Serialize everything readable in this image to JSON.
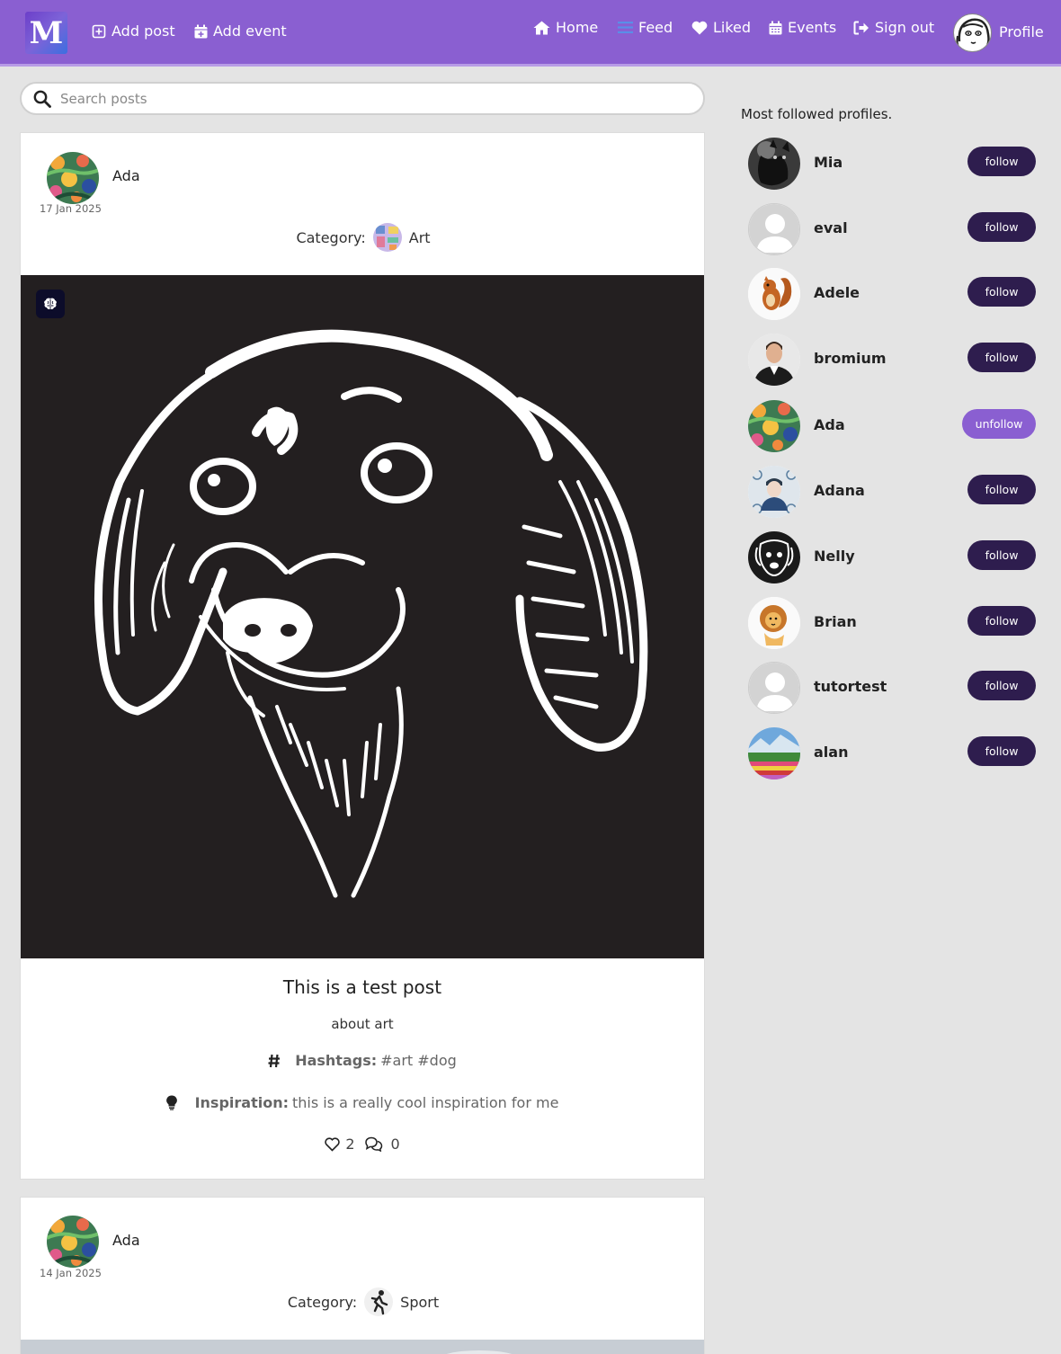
{
  "nav": {
    "logo_letter": "M",
    "add_post": "Add post",
    "add_event": "Add event",
    "home": "Home",
    "feed": "Feed",
    "liked": "Liked",
    "events": "Events",
    "sign_out": "Sign out",
    "profile": "Profile"
  },
  "search": {
    "placeholder": "Search posts"
  },
  "posts": [
    {
      "author": "Ada",
      "date": "17 Jan 2025",
      "category_label": "Category:",
      "category": "Art",
      "title": "This is a test post",
      "subtitle": "about art",
      "hashtags_label": "Hashtags:",
      "hashtags": "#art #dog",
      "inspiration_label": "Inspiration:",
      "inspiration": "this is a really cool inspiration for me",
      "likes": "2",
      "comments": "0"
    },
    {
      "author": "Ada",
      "date": "14 Jan 2025",
      "category_label": "Category:",
      "category": "Sport"
    }
  ],
  "sidebar": {
    "title": "Most followed profiles.",
    "profiles": [
      {
        "name": "Mia",
        "action": "follow"
      },
      {
        "name": "eval",
        "action": "follow"
      },
      {
        "name": "Adele",
        "action": "follow"
      },
      {
        "name": "bromium",
        "action": "follow"
      },
      {
        "name": "Ada",
        "action": "unfollow"
      },
      {
        "name": "Adana",
        "action": "follow"
      },
      {
        "name": "Nelly",
        "action": "follow"
      },
      {
        "name": "Brian",
        "action": "follow"
      },
      {
        "name": "tutortest",
        "action": "follow"
      },
      {
        "name": "alan",
        "action": "follow"
      }
    ]
  },
  "colors": {
    "navbar": "#8a5fd1",
    "follow_button": "#2e1d4e",
    "unfollow_button": "#8a5fd1"
  },
  "icons": [
    "plus-square-icon",
    "calendar-plus-icon",
    "home-icon",
    "bars-icon",
    "heart-icon",
    "calendar-icon",
    "sign-out-icon",
    "search-icon",
    "hashtag-icon",
    "lightbulb-icon",
    "comments-icon",
    "brain-icon"
  ]
}
